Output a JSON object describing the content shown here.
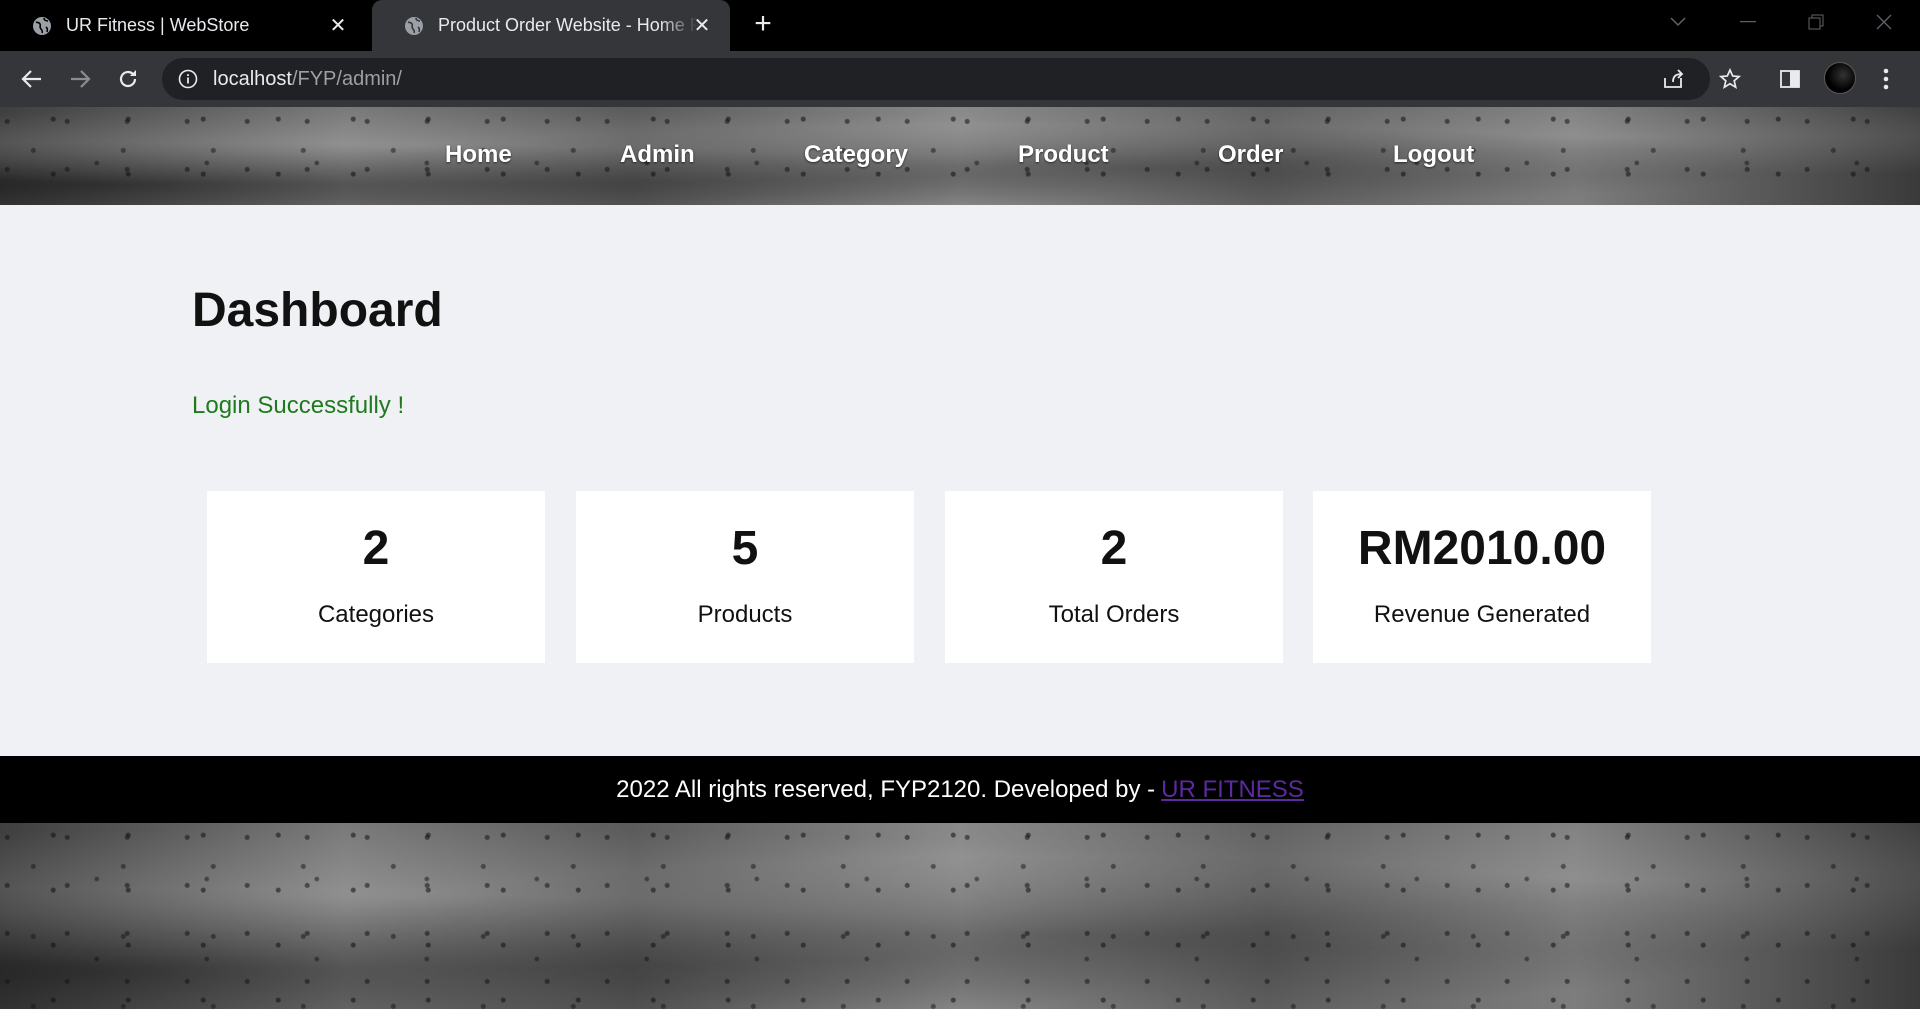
{
  "browser": {
    "tabs": [
      {
        "title": "UR Fitness | WebStore",
        "active": false
      },
      {
        "title": "Product Order Website - Home Page",
        "active": true
      }
    ],
    "url_host": "localhost",
    "url_path": "/FYP/admin/",
    "icons": {
      "back": "arrow-left-icon",
      "forward": "arrow-right-icon",
      "reload": "reload-icon",
      "info": "info-icon",
      "share": "share-icon",
      "bookmark": "star-icon",
      "sidepanel": "side-panel-icon",
      "menu": "kebab-menu-icon"
    }
  },
  "site": {
    "nav": [
      "Home",
      "Admin",
      "Category",
      "Product",
      "Order",
      "Logout"
    ],
    "title": "Dashboard",
    "message": "Login Successfully !",
    "cards": [
      {
        "value": "2",
        "label": "Categories"
      },
      {
        "value": "5",
        "label": "Products"
      },
      {
        "value": "2",
        "label": "Total Orders"
      },
      {
        "value": "RM2010.00",
        "label": "Revenue Generated"
      }
    ],
    "footer_text": "2022 All rights reserved, FYP2120. Developed by -",
    "footer_link": "UR FITNESS"
  },
  "colors": {
    "page_bg": "#f0f1f4",
    "success_text": "#1e7a1e",
    "footer_link": "#5b2a9f"
  }
}
